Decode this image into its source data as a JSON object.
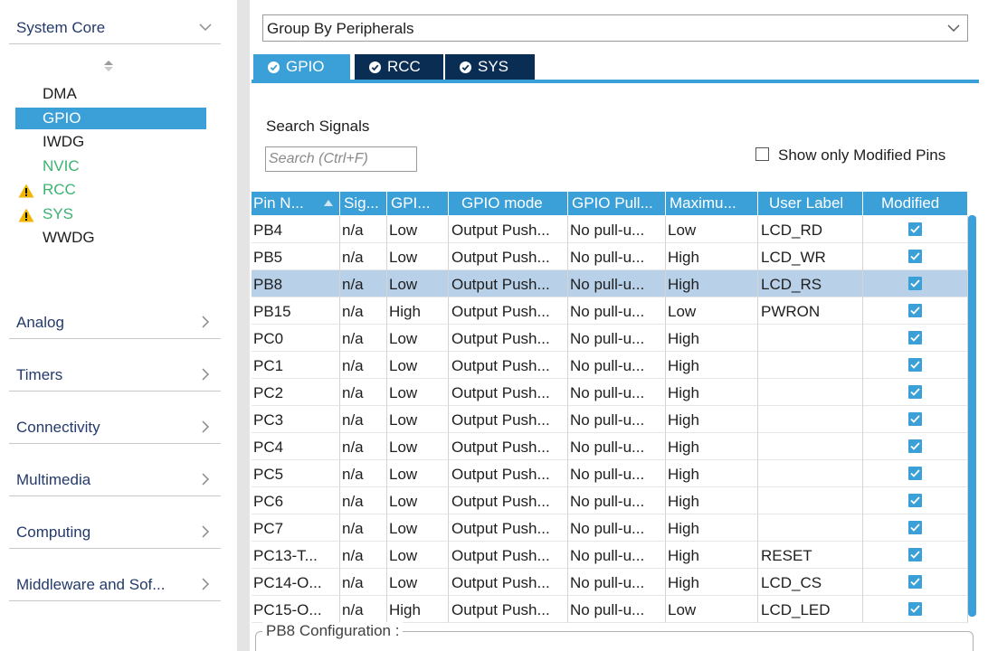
{
  "sidebar": {
    "system_core": {
      "label": "System Core"
    },
    "peripherals": [
      {
        "name": "DMA",
        "state": "normal"
      },
      {
        "name": "GPIO",
        "state": "selected"
      },
      {
        "name": "IWDG",
        "state": "normal"
      },
      {
        "name": "NVIC",
        "state": "green"
      },
      {
        "name": "RCC",
        "state": "warning"
      },
      {
        "name": "SYS",
        "state": "warning"
      },
      {
        "name": "WWDG",
        "state": "normal"
      }
    ],
    "categories": [
      {
        "label": "Analog"
      },
      {
        "label": "Timers"
      },
      {
        "label": "Connectivity"
      },
      {
        "label": "Multimedia"
      },
      {
        "label": "Computing"
      },
      {
        "label": "Middleware and Sof..."
      }
    ]
  },
  "group_select": {
    "value": "Group By Peripherals"
  },
  "tabs": [
    {
      "label": "GPIO",
      "active": true
    },
    {
      "label": "RCC",
      "active": false
    },
    {
      "label": "SYS",
      "active": false
    }
  ],
  "search": {
    "label": "Search Signals",
    "placeholder": "Search (Ctrl+F)"
  },
  "show_modified": {
    "label": "Show only Modified Pins",
    "checked": false
  },
  "table": {
    "headers": [
      "Pin N...",
      "Sig...",
      "GPI...",
      "GPIO mode",
      "GPIO Pull...",
      "Maximu...",
      "User Label",
      "Modified"
    ],
    "rows": [
      {
        "pin": "PB4",
        "signal": "n/a",
        "gpio": "Low",
        "mode": "Output Push...",
        "pull": "No pull-u...",
        "max": "Low",
        "label": "LCD_RD",
        "modified": true
      },
      {
        "pin": "PB5",
        "signal": "n/a",
        "gpio": "Low",
        "mode": "Output Push...",
        "pull": "No pull-u...",
        "max": "High",
        "label": "LCD_WR",
        "modified": true
      },
      {
        "pin": "PB8",
        "signal": "n/a",
        "gpio": "Low",
        "mode": "Output Push...",
        "pull": "No pull-u...",
        "max": "High",
        "label": "LCD_RS",
        "modified": true,
        "selected": true
      },
      {
        "pin": "PB15",
        "signal": "n/a",
        "gpio": "High",
        "mode": "Output Push...",
        "pull": "No pull-u...",
        "max": "Low",
        "label": "PWRON",
        "modified": true
      },
      {
        "pin": "PC0",
        "signal": "n/a",
        "gpio": "Low",
        "mode": "Output Push...",
        "pull": "No pull-u...",
        "max": "High",
        "label": "",
        "modified": true
      },
      {
        "pin": "PC1",
        "signal": "n/a",
        "gpio": "Low",
        "mode": "Output Push...",
        "pull": "No pull-u...",
        "max": "High",
        "label": "",
        "modified": true
      },
      {
        "pin": "PC2",
        "signal": "n/a",
        "gpio": "Low",
        "mode": "Output Push...",
        "pull": "No pull-u...",
        "max": "High",
        "label": "",
        "modified": true
      },
      {
        "pin": "PC3",
        "signal": "n/a",
        "gpio": "Low",
        "mode": "Output Push...",
        "pull": "No pull-u...",
        "max": "High",
        "label": "",
        "modified": true
      },
      {
        "pin": "PC4",
        "signal": "n/a",
        "gpio": "Low",
        "mode": "Output Push...",
        "pull": "No pull-u...",
        "max": "High",
        "label": "",
        "modified": true
      },
      {
        "pin": "PC5",
        "signal": "n/a",
        "gpio": "Low",
        "mode": "Output Push...",
        "pull": "No pull-u...",
        "max": "High",
        "label": "",
        "modified": true
      },
      {
        "pin": "PC6",
        "signal": "n/a",
        "gpio": "Low",
        "mode": "Output Push...",
        "pull": "No pull-u...",
        "max": "High",
        "label": "",
        "modified": true
      },
      {
        "pin": "PC7",
        "signal": "n/a",
        "gpio": "Low",
        "mode": "Output Push...",
        "pull": "No pull-u...",
        "max": "High",
        "label": "",
        "modified": true
      },
      {
        "pin": "PC13-T...",
        "signal": "n/a",
        "gpio": "Low",
        "mode": "Output Push...",
        "pull": "No pull-u...",
        "max": "High",
        "label": "RESET",
        "modified": true
      },
      {
        "pin": "PC14-O...",
        "signal": "n/a",
        "gpio": "Low",
        "mode": "Output Push...",
        "pull": "No pull-u...",
        "max": "High",
        "label": "LCD_CS",
        "modified": true
      },
      {
        "pin": "PC15-O...",
        "signal": "n/a",
        "gpio": "High",
        "mode": "Output Push...",
        "pull": "No pull-u...",
        "max": "Low",
        "label": "LCD_LED",
        "modified": true
      }
    ]
  },
  "config": {
    "label": "PB8 Configuration :"
  },
  "colors": {
    "accent": "#3ba0d8",
    "tab_dark": "#0a2d54",
    "selected_row": "#b9d1e8",
    "nvic_green": "#3cb371",
    "warning": "#f2b600"
  }
}
